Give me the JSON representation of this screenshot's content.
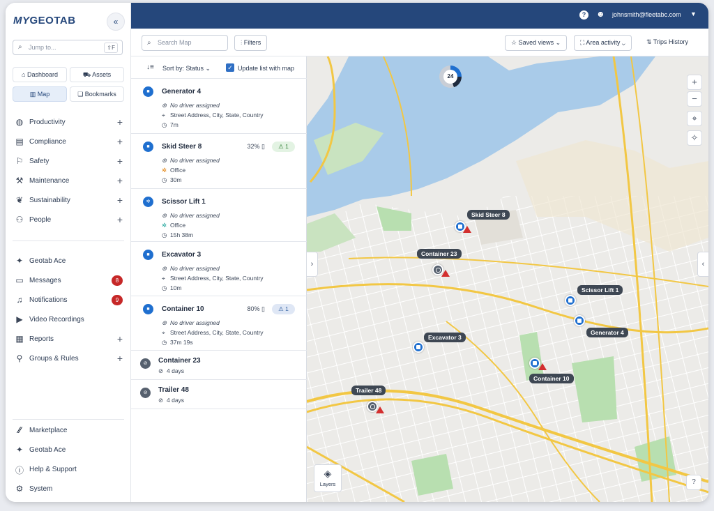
{
  "app": {
    "logo_my": "MY",
    "logo_name": "GEOTAB",
    "collapse": "«"
  },
  "sidebar": {
    "jump_placeholder": "Jump to...",
    "jump_shortcut": "⇧F",
    "quick": [
      {
        "label": "Dashboard",
        "icon": "home-icon"
      },
      {
        "label": "Assets",
        "icon": "truck-icon"
      },
      {
        "label": "Map",
        "icon": "map-icon"
      },
      {
        "label": "Bookmarks",
        "icon": "bookmark-icon"
      }
    ],
    "items": [
      {
        "label": "Productivity",
        "icon": "globe-icon",
        "action": "+"
      },
      {
        "label": "Compliance",
        "icon": "document-icon",
        "action": "+"
      },
      {
        "label": "Safety",
        "icon": "safety-icon",
        "action": "+"
      },
      {
        "label": "Maintenance",
        "icon": "wrench-icon",
        "action": "+"
      },
      {
        "label": "Sustainability",
        "icon": "leaf-icon",
        "action": "+"
      },
      {
        "label": "People",
        "icon": "people-icon",
        "action": "+"
      }
    ],
    "items2": [
      {
        "label": "Geotab Ace",
        "icon": "sparkle-icon"
      },
      {
        "label": "Messages",
        "icon": "message-icon",
        "badge": "8"
      },
      {
        "label": "Notifications",
        "icon": "bell-icon",
        "badge": "9"
      },
      {
        "label": "Video Recordings",
        "icon": "video-icon"
      },
      {
        "label": "Reports",
        "icon": "report-icon",
        "action": "+"
      },
      {
        "label": "Groups & Rules",
        "icon": "groups-icon",
        "action": "+"
      }
    ],
    "items3": [
      {
        "label": "Marketplace",
        "icon": "marketplace-icon"
      },
      {
        "label": "Geotab Ace",
        "icon": "sparkle-icon"
      },
      {
        "label": "Help & Support",
        "icon": "help-icon"
      },
      {
        "label": "System",
        "icon": "gear-icon"
      }
    ]
  },
  "topbar": {
    "help": "?",
    "email": "johnsmith@fleetabc.com"
  },
  "toolbar": {
    "search_placeholder": "Search Map",
    "filters": "Filters",
    "saved_views": "Saved views",
    "area_activity": "Area activity",
    "trips_history": "Trips History"
  },
  "list": {
    "sort_label": "Sort by: Status",
    "update_label": "Update list with map",
    "assets": [
      {
        "name": "Generator 4",
        "driver": "No driver assigned",
        "location": "Street Address, City, State, Country",
        "time": "7m"
      },
      {
        "name": "Skid Steer 8",
        "driver": "No driver assigned",
        "location": "Office",
        "time": "30m",
        "battery": "32%",
        "warnings": "1"
      },
      {
        "name": "Scissor Lift 1",
        "driver": "No driver assigned",
        "location": "Office",
        "time": "15h 38m"
      },
      {
        "name": "Excavator 3",
        "driver": "No driver assigned",
        "location": "Street Address, City, State, Country",
        "time": "10m"
      },
      {
        "name": "Container 10",
        "driver": "No driver assigned",
        "location": "Street Address, City, State, Country",
        "time": "37m 19s",
        "battery": "80%",
        "warnings": "1"
      },
      {
        "name": "Container 23",
        "time": "4 days"
      },
      {
        "name": "Trailer 48",
        "time": "4 days"
      }
    ]
  },
  "map": {
    "cluster_count": "24",
    "layers_label": "Layers",
    "markers": [
      "Skid Steer 8",
      "Container 23",
      "Scissor Lift 1",
      "Generator 4",
      "Excavator 3",
      "Container 10",
      "Trailer 48"
    ],
    "colors": {
      "water": "#a9cbe9",
      "park": "#b8dfb0",
      "road": "#f2c744",
      "street": "#ffffff",
      "land": "#ecebe8"
    }
  }
}
